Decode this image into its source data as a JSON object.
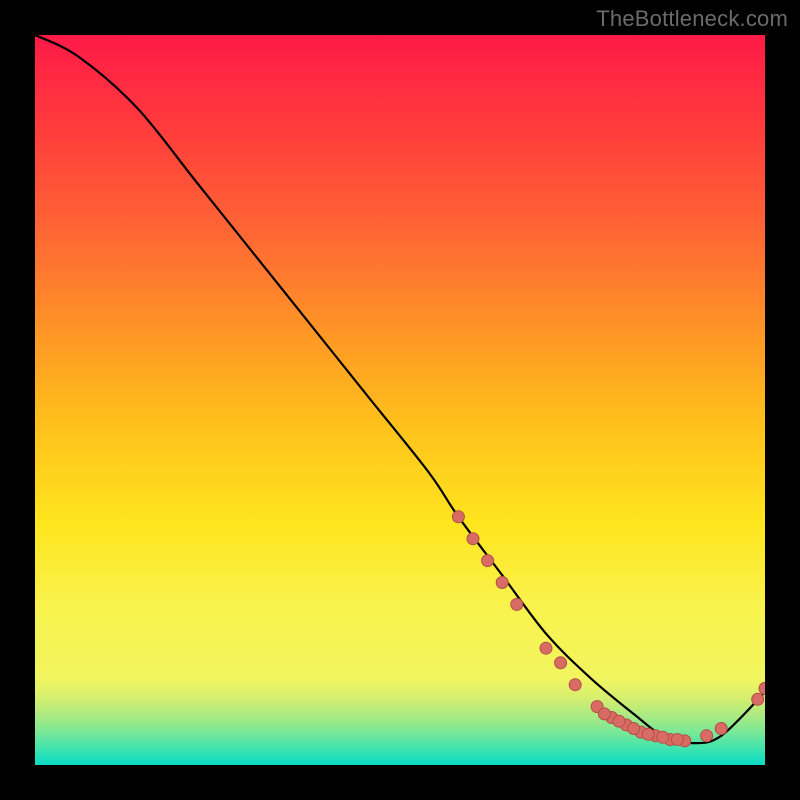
{
  "watermark": "TheBottleneck.com",
  "chart_data": {
    "type": "line",
    "title": "",
    "xlabel": "",
    "ylabel": "",
    "ylim": [
      0,
      100
    ],
    "xlim": [
      0,
      100
    ],
    "series": [
      {
        "name": "bottleneck-curve",
        "x": [
          0,
          6,
          14,
          22,
          30,
          38,
          46,
          54,
          58,
          64,
          70,
          76,
          82,
          86,
          90,
          94,
          100
        ],
        "y": [
          100,
          97,
          90,
          80,
          70,
          60,
          50,
          40,
          34,
          26,
          18,
          12,
          7,
          4,
          3,
          4,
          10
        ]
      }
    ],
    "highlight_cluster": {
      "name": "curve-dots",
      "points": [
        {
          "x": 58,
          "y": 34
        },
        {
          "x": 60,
          "y": 31
        },
        {
          "x": 62,
          "y": 28
        },
        {
          "x": 64,
          "y": 25
        },
        {
          "x": 66,
          "y": 22
        },
        {
          "x": 70,
          "y": 16
        },
        {
          "x": 72,
          "y": 14
        },
        {
          "x": 74,
          "y": 11
        },
        {
          "x": 77,
          "y": 8
        },
        {
          "x": 79,
          "y": 6.5
        },
        {
          "x": 81,
          "y": 5.5
        },
        {
          "x": 83,
          "y": 4.5
        },
        {
          "x": 85,
          "y": 4
        },
        {
          "x": 87,
          "y": 3.5
        },
        {
          "x": 89,
          "y": 3.3
        },
        {
          "x": 92,
          "y": 4
        },
        {
          "x": 94,
          "y": 5
        },
        {
          "x": 99,
          "y": 9
        },
        {
          "x": 100,
          "y": 10.5
        },
        {
          "x": 78,
          "y": 7
        },
        {
          "x": 80,
          "y": 6
        },
        {
          "x": 82,
          "y": 5
        },
        {
          "x": 84,
          "y": 4.2
        },
        {
          "x": 86,
          "y": 3.8
        },
        {
          "x": 88,
          "y": 3.5
        }
      ]
    },
    "colors": {
      "curve": "#000000",
      "dot_fill": "#d86b63",
      "dot_stroke": "#b34f47",
      "gradient_top": "#ff1a48",
      "gradient_bottom": "#0edac6"
    }
  }
}
